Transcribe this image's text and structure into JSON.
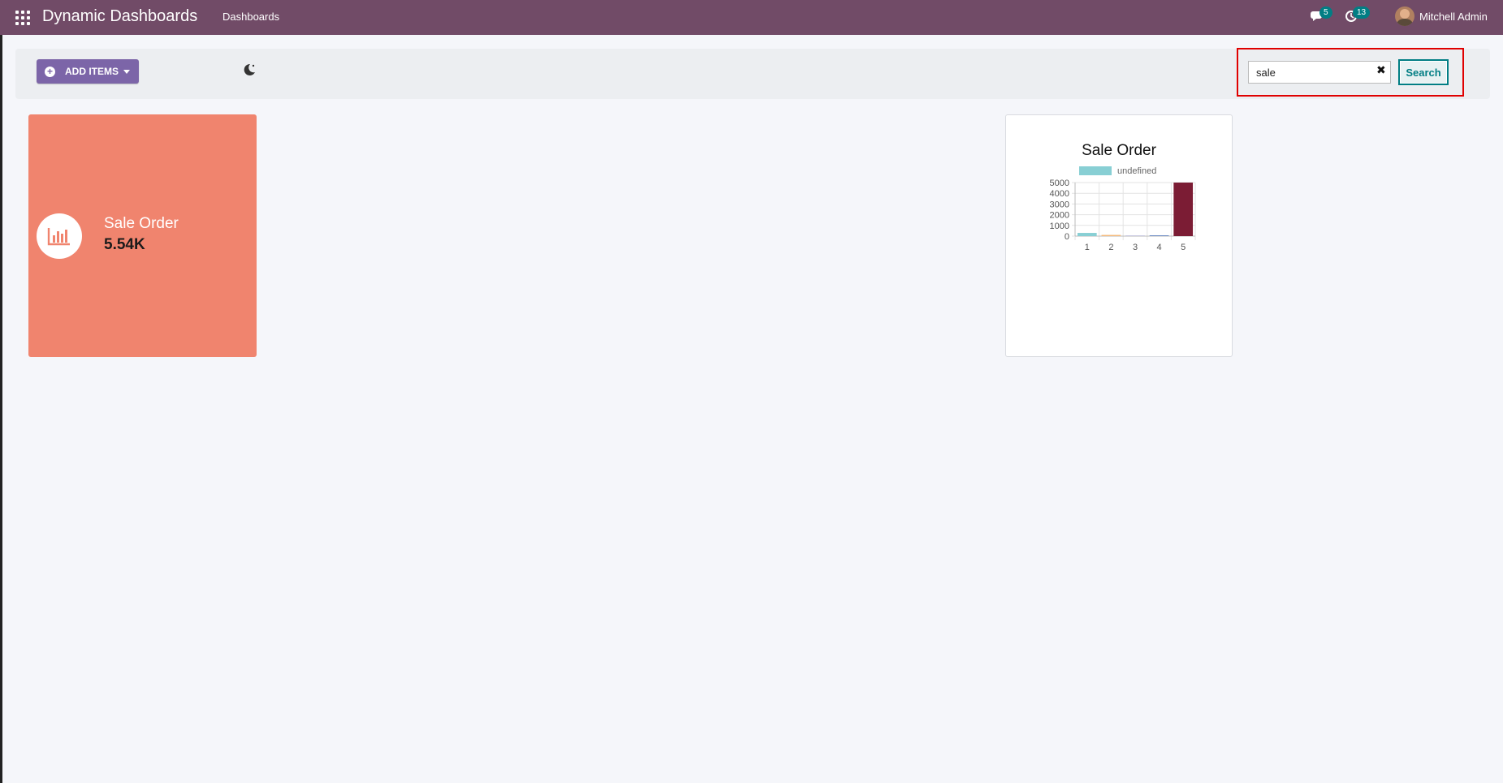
{
  "navbar": {
    "brand": "Dynamic Dashboards",
    "menu_item": "Dashboards",
    "messages_count": "5",
    "activities_count": "13",
    "user_name": "Mitchell Admin"
  },
  "control_panel": {
    "add_items_label": "ADD ITEMS",
    "search_value": "sale",
    "search_button": "Search"
  },
  "tile": {
    "title": "Sale Order",
    "value": "5.54K",
    "color": "#f0846e"
  },
  "chart_card": {
    "title": "Sale Order"
  },
  "chart_data": {
    "type": "bar",
    "title": "Sale Order",
    "categories": [
      "1",
      "2",
      "3",
      "4",
      "5"
    ],
    "series": [
      {
        "name": "undefined",
        "values": [
          300,
          110,
          50,
          40,
          5000
        ]
      }
    ],
    "bar_colors": [
      "#88cfd4",
      "#f4b97a",
      "#c7c7e0",
      "#6a89c2",
      "#7b1c34"
    ],
    "legend_color": "#88cfd4",
    "ylim": [
      0,
      5000
    ],
    "yticks": [
      0,
      1000,
      2000,
      3000,
      4000,
      5000
    ],
    "grid": true,
    "legend_position": "top",
    "xlabel": "",
    "ylabel": ""
  },
  "colors": {
    "navbar": "#714b67",
    "primary_button": "#7c65a8",
    "accent": "#017e84"
  }
}
